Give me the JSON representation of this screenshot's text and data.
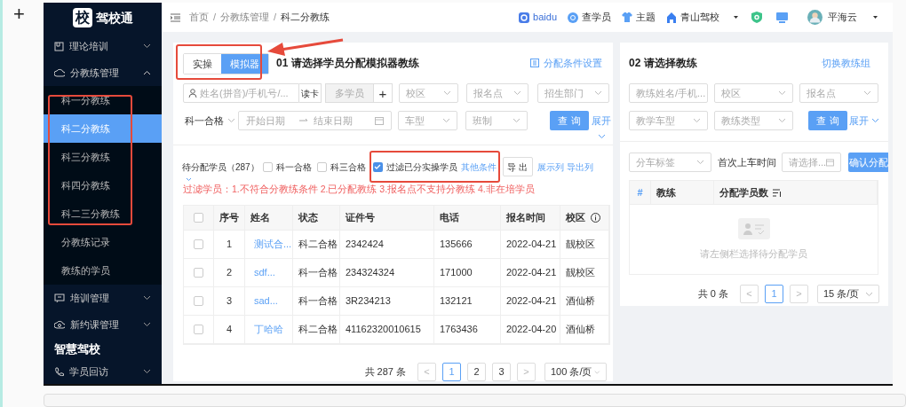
{
  "page_plus": "+",
  "sidebar": {
    "logo_mark": "校",
    "logo_text": "驾校通",
    "items": [
      {
        "kind": "group",
        "label": "理论培训",
        "expanded": false
      },
      {
        "kind": "group",
        "label": "分教练管理",
        "expanded": true,
        "children": [
          {
            "label": "科一分教练",
            "selected": false
          },
          {
            "label": "科二分教练",
            "selected": true
          },
          {
            "label": "科三分教练",
            "selected": false
          },
          {
            "label": "科四分教练",
            "selected": false
          },
          {
            "label": "科二三分教练",
            "selected": false
          },
          {
            "label": "分教练记录",
            "selected": false
          },
          {
            "label": "教练的学员",
            "selected": false
          }
        ]
      },
      {
        "kind": "group",
        "label": "培训管理",
        "expanded": false
      },
      {
        "kind": "group",
        "label": "新约课管理",
        "expanded": false
      },
      {
        "kind": "section",
        "label": "智慧驾校"
      },
      {
        "kind": "group",
        "label": "学员回访",
        "expanded": false
      }
    ]
  },
  "header": {
    "breadcrumb": [
      "首页",
      "分教练管理",
      "科二分教练"
    ],
    "separator": "/",
    "links": [
      "baidu",
      "查学员",
      "主题",
      "青山驾校"
    ],
    "user": "平海云"
  },
  "student_panel": {
    "modes": [
      {
        "label": "实操",
        "selected": false
      },
      {
        "label": "模拟器",
        "selected": true
      }
    ],
    "title": "01 请选择学员分配模拟器教练",
    "settings_link": "分配条件设置",
    "name_placeholder": "姓名(拼音)/手机号/...",
    "read_card": "读卡",
    "multi": "多学员",
    "add": "+",
    "row1_selects": [
      "校区",
      "报名点",
      "招生部门"
    ],
    "subject": "科一合格",
    "start_date": "开始日期",
    "end_date": "结束日期",
    "row2_selects": [
      "车型",
      "班制"
    ],
    "search": "查 询",
    "expand": "展开",
    "count_label": "待分配学员（287）",
    "checkboxes": [
      {
        "label": "科一合格",
        "checked": false
      },
      {
        "label": "科三合格",
        "checked": false
      },
      {
        "label": "过滤已分实操学员",
        "checked": true
      }
    ],
    "other": "其他条件",
    "export": "导 出",
    "show_cols": "展示列",
    "export_cols": "导出列",
    "note": "过滤学员：1.不符合分教练条件 2.已分配教练 3.报名点不支持分教练 4.非在培学员",
    "select_all_checked": false,
    "prev": "<",
    "next": ">",
    "columns": [
      "序号",
      "姓名",
      "状态",
      "证件号",
      "电话",
      "报名时间",
      "校区"
    ],
    "rows": [
      {
        "cells": [
          "1",
          "测试合...",
          "科二合格",
          "2342424",
          "135666",
          "2022-04-21",
          "靓校区"
        ],
        "checked": false
      },
      {
        "cells": [
          "2",
          "sdf...",
          "科一合格",
          "234324324",
          "171000",
          "2022-04-21",
          "靓校区"
        ],
        "checked": false
      },
      {
        "cells": [
          "3",
          "sad...",
          "科一合格",
          "3R234213",
          "132121",
          "2022-04-21",
          "酒仙桥"
        ],
        "checked": false
      },
      {
        "cells": [
          "4",
          "丁哈哈",
          "科二合格",
          "41162320010615",
          "1763436",
          "2022-04-20",
          "酒仙桥"
        ],
        "checked": false
      }
    ],
    "total": "共 287 条",
    "pages": [
      {
        "label": "1",
        "selected": true
      },
      {
        "label": "2",
        "selected": false
      },
      {
        "label": "3",
        "selected": false
      }
    ],
    "page_size": "100 条/页"
  },
  "coach_panel": {
    "title": "02 请选择教练",
    "switch_link": "切换教练组",
    "name_placeholder": "教练姓名/手机...",
    "row1_selects": [
      "校区",
      "报名点"
    ],
    "row2_selects": [
      "教学车型",
      "教练类型"
    ],
    "search": "查 询",
    "expand": "展开",
    "tag_select": "分车标签",
    "first_time_label": "首次上车时间",
    "date_placeholder": "请选择...",
    "confirm": "确认分配",
    "prev": "<",
    "next": ">",
    "columns": [
      "#",
      "教练",
      "分配学员数"
    ],
    "empty": "请左侧栏选择待分配学员",
    "total": "共 0 条",
    "pages": [
      {
        "label": "1",
        "selected": true
      }
    ],
    "page_size": "15 条/页"
  }
}
